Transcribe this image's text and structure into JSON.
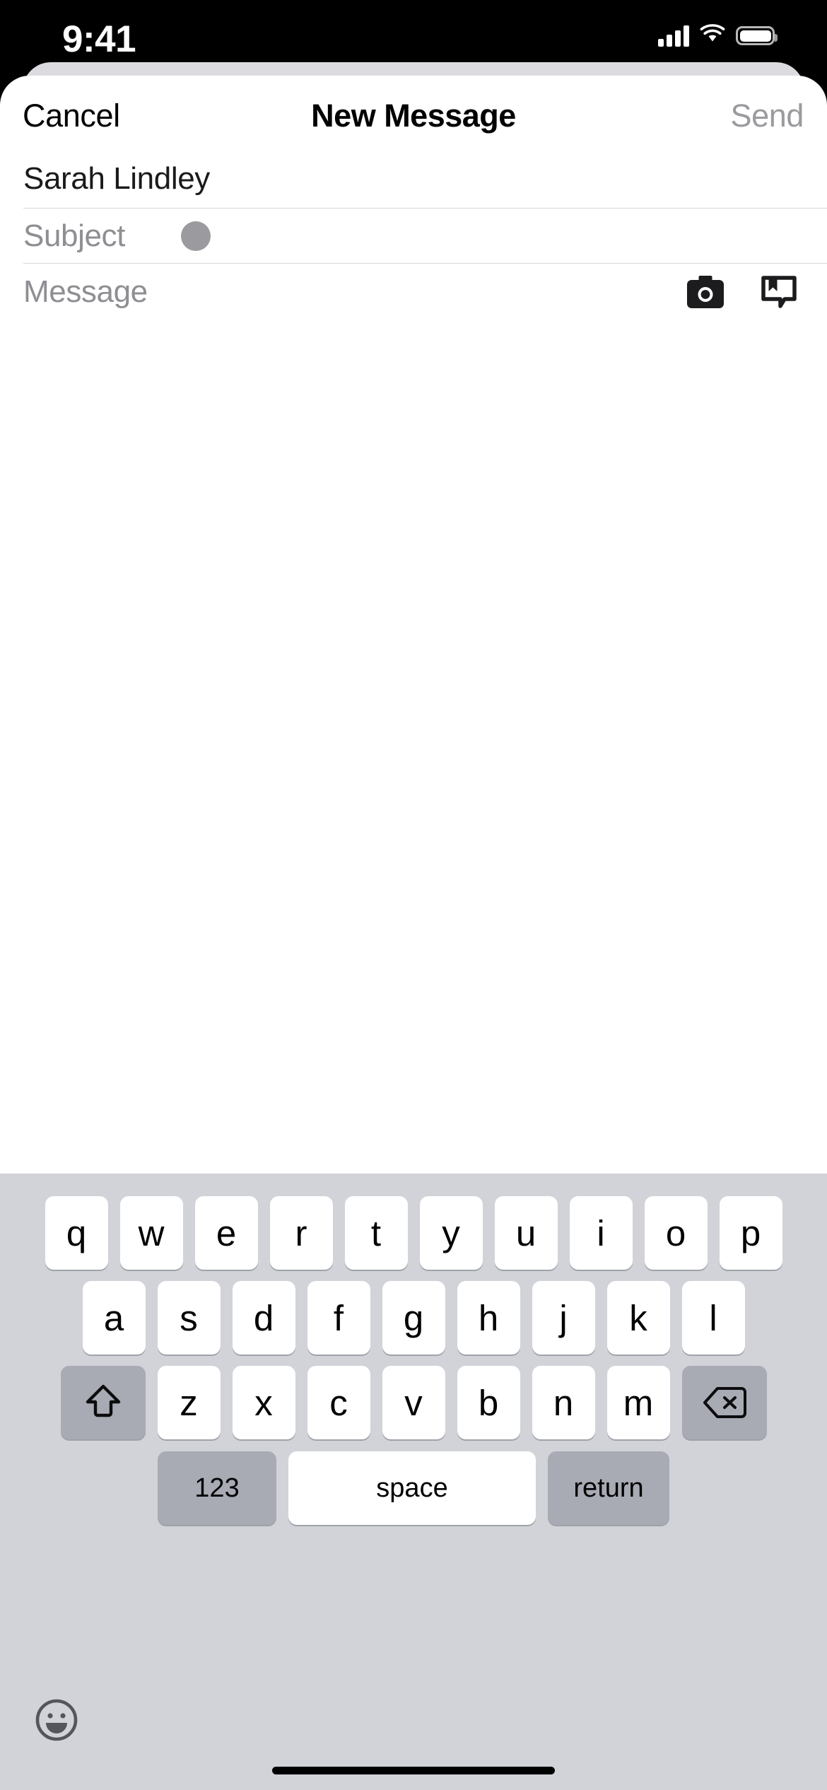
{
  "status_bar": {
    "time": "9:41",
    "signal_icon": "cellular-bars-icon",
    "wifi_icon": "wifi-icon",
    "battery_icon": "battery-icon"
  },
  "nav_bar": {
    "cancel_label": "Cancel",
    "title": "New Message",
    "send_label": "Send",
    "send_enabled": false,
    "send_color": "#9a9a9f"
  },
  "compose": {
    "recipient": {
      "value": "Sarah Lindley"
    },
    "subject": {
      "placeholder": "Subject",
      "value": "",
      "cursor_dot_color": "#9b9b9f"
    },
    "message": {
      "placeholder": "Message",
      "value": "",
      "camera_icon": "camera-icon",
      "markup_icon": "digital-touch-icon"
    }
  },
  "keyboard": {
    "row1": [
      "q",
      "w",
      "e",
      "r",
      "t",
      "y",
      "u",
      "i",
      "o",
      "p"
    ],
    "row2": [
      "a",
      "s",
      "d",
      "f",
      "g",
      "h",
      "j",
      "k",
      "l"
    ],
    "row3": [
      "z",
      "x",
      "c",
      "v",
      "b",
      "n",
      "m"
    ],
    "shift_label": "shift",
    "shift_icon": "shift-arrow-icon",
    "backspace_label": "delete",
    "backspace_icon": "backspace-icon",
    "numbers_label": "123",
    "space_label": "space",
    "return_label": "return",
    "emoji_icon": "emoji-smiley-icon",
    "key_bg": "#ffffff",
    "modifier_key_bg": "#a8aab4",
    "keyboard_bg": "#d1d3d9"
  },
  "home_indicator": {
    "visible": true
  }
}
